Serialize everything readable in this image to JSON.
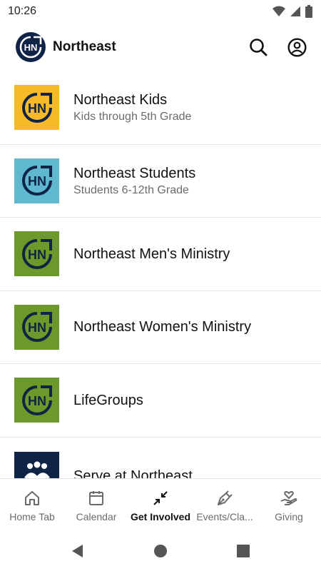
{
  "status_bar": {
    "time": "10:26"
  },
  "header": {
    "title": "Northeast",
    "logo_text": "HN",
    "search_icon": "search-icon",
    "account_icon": "account-icon"
  },
  "items": [
    {
      "title": "Northeast Kids",
      "subtitle": "Kids through 5th Grade",
      "color": "#f7b928",
      "icon_text": "HN"
    },
    {
      "title": "Northeast Students",
      "subtitle": "Students 6-12th Grade",
      "color": "#5fb8cf",
      "icon_text": "HN"
    },
    {
      "title": "Northeast Men's Ministry",
      "subtitle": "",
      "color": "#6b9a2a",
      "icon_text": "HN"
    },
    {
      "title": "Northeast Women's Ministry",
      "subtitle": "",
      "color": "#6b9a2a",
      "icon_text": "HN"
    },
    {
      "title": "LifeGroups",
      "subtitle": "",
      "color": "#6b9a2a",
      "icon_text": "HN"
    },
    {
      "title": "Serve at Northeast",
      "subtitle": "",
      "color": "#0f2346",
      "icon_text": ""
    }
  ],
  "bottom_nav": [
    {
      "label": "Home Tab",
      "icon": "home-icon",
      "active": false
    },
    {
      "label": "Calendar",
      "icon": "calendar-icon",
      "active": false
    },
    {
      "label": "Get Involved",
      "icon": "collapse-arrows-icon",
      "active": true
    },
    {
      "label": "Events/Cla...",
      "icon": "pen-nib-icon",
      "active": false
    },
    {
      "label": "Giving",
      "icon": "heart-hand-icon",
      "active": false
    }
  ],
  "colors": {
    "navy": "#0f2346",
    "yellow": "#f7b928",
    "teal": "#5fb8cf",
    "green": "#6b9a2a"
  }
}
